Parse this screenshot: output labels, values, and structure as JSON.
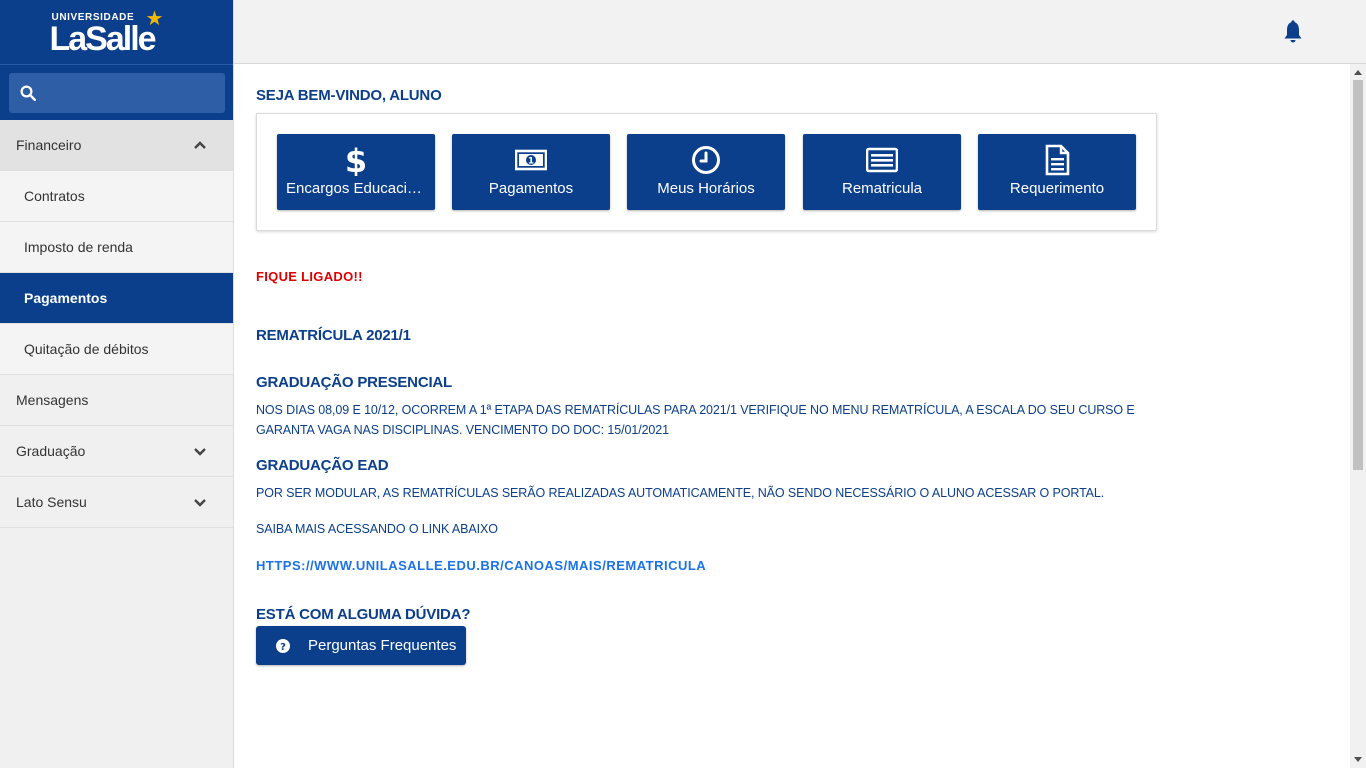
{
  "brand": {
    "top": "UNIVERSIDADE",
    "main": "LaSalle"
  },
  "search": {
    "placeholder": ""
  },
  "sidebar": {
    "items": [
      {
        "label": "Financeiro"
      },
      {
        "label": "Contratos"
      },
      {
        "label": "Imposto de renda"
      },
      {
        "label": "Pagamentos"
      },
      {
        "label": "Quitação de débitos"
      },
      {
        "label": "Mensagens"
      },
      {
        "label": "Graduação"
      },
      {
        "label": "Lato Sensu"
      }
    ]
  },
  "main": {
    "welcome": "SEJA BEM-VINDO, ALUNO",
    "cards": [
      {
        "label": "Encargos Educacionais",
        "icon": "dollar-icon"
      },
      {
        "label": "Pagamentos",
        "icon": "money-bill-icon"
      },
      {
        "label": "Meus Horários",
        "icon": "clock-icon"
      },
      {
        "label": "Rematricula",
        "icon": "list-icon"
      },
      {
        "label": "Requerimento",
        "icon": "document-icon"
      }
    ],
    "alert": "FIQUE LIGADO!!",
    "rematricula_title": "REMATRÍCULA 2021/1",
    "presencial_title": "GRADUAÇÃO PRESENCIAL",
    "presencial_text": "NOS DIAS 08,09 E 10/12, OCORREM A 1ª ETAPA DAS REMATRÍCULAS PARA 2021/1 VERIFIQUE NO MENU REMATRÍCULA, A ESCALA DO SEU CURSO E GARANTA VAGA NAS DISCIPLINAS. VENCIMENTO DO DOC: 15/01/2021",
    "ead_title": "GRADUAÇÃO EAD",
    "ead_text": "POR SER MODULAR, AS REMATRÍCULAS SERÃO REALIZADAS AUTOMATICAMENTE, NÃO SENDO NECESSÁRIO O ALUNO ACESSAR O PORTAL.",
    "saiba_text": "SAIBA MAIS ACESSANDO O LINK ABAIXO",
    "link": "HTTPS://WWW.UNILASALLE.EDU.BR/CANOAS/MAIS/REMATRICULA",
    "duvida_title": "ESTÁ COM ALGUMA DÚVIDA?",
    "faq_label": "Perguntas Frequentes"
  },
  "colors": {
    "primary": "#0b3f8c",
    "alert": "#e00000",
    "link": "#1a73e8",
    "star": "#f2b800"
  }
}
